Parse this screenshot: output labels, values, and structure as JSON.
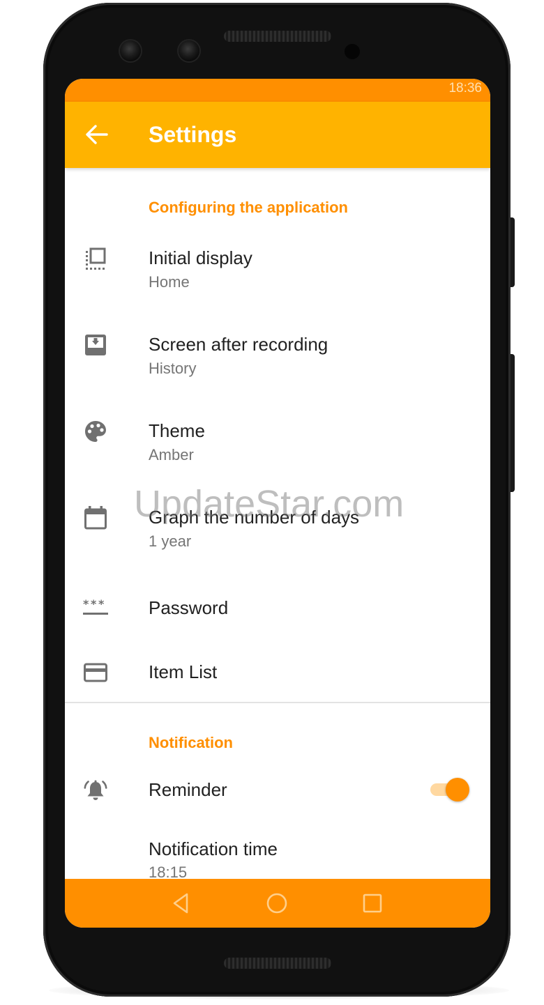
{
  "status_bar": {
    "time": "18:36"
  },
  "app_bar": {
    "title": "Settings",
    "back_icon": "arrow-back-icon"
  },
  "sections": [
    {
      "header": "Configuring the application",
      "items": [
        {
          "title": "Initial display",
          "summary": "Home",
          "icon": "initial-display-icon"
        },
        {
          "title": "Screen after recording",
          "summary": "History",
          "icon": "inbox-download-icon"
        },
        {
          "title": "Theme",
          "summary": "Amber",
          "icon": "palette-icon"
        },
        {
          "title": "Graph the number of days",
          "summary": "1 year",
          "icon": "calendar-icon"
        },
        {
          "title": "Password",
          "icon": "password-icon"
        },
        {
          "title": "Item List",
          "icon": "credit-card-icon"
        }
      ]
    },
    {
      "header": "Notification",
      "items": [
        {
          "title": "Reminder",
          "icon": "bell-icon",
          "toggle": true
        },
        {
          "title": "Notification time",
          "summary": "18:15"
        }
      ]
    }
  ],
  "nav_bar": {
    "back": "nav-back-icon",
    "home": "nav-home-icon",
    "recents": "nav-recents-icon"
  },
  "watermark": "UpdateStar.com",
  "colors": {
    "accent": "#ff8f00",
    "app_bar": "#ffb300",
    "status_bar": "#ff8f00",
    "nav_bar": "#ff8f00"
  }
}
